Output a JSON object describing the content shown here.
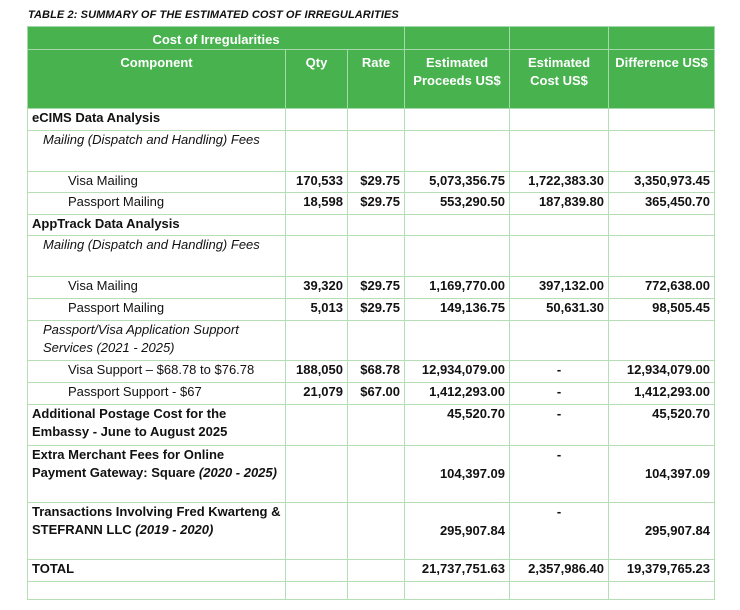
{
  "caption": "TABLE 2: SUMMARY OF THE ESTIMATED COST OF IRREGULARITIES",
  "header": {
    "group": "Cost of Irregularities",
    "component": "Component",
    "qty": "Qty",
    "rate": "Rate",
    "proceeds": "Estimated Proceeds US$",
    "cost": "Estimated Cost US$",
    "difference": "Difference US$"
  },
  "sections": {
    "ecims": "eCIMS Data Analysis",
    "ecims_mailing": "Mailing (Dispatch and Handling) Fees",
    "apptrack": "AppTrack Data Analysis",
    "apptrack_mailing": "Mailing (Dispatch and Handling) Fees",
    "support": "Passport/Visa Application Support Services (2021 - 2025)"
  },
  "rows": {
    "ecims_visa": {
      "label": "Visa Mailing",
      "qty": "170,533",
      "rate": "$29.75",
      "proceeds": "5,073,356.75",
      "cost": "1,722,383.30",
      "diff": "3,350,973.45"
    },
    "ecims_passport": {
      "label": "Passport Mailing",
      "qty": "18,598",
      "rate": "$29.75",
      "proceeds": "553,290.50",
      "cost": "187,839.80",
      "diff": "365,450.70"
    },
    "app_visa": {
      "label": "Visa Mailing",
      "qty": "39,320",
      "rate": "$29.75",
      "proceeds": "1,169,770.00",
      "cost": "397,132.00",
      "diff": "772,638.00"
    },
    "app_passport": {
      "label": "Passport Mailing",
      "qty": "5,013",
      "rate": "$29.75",
      "proceeds": "149,136.75",
      "cost": "50,631.30",
      "diff": "98,505.45"
    },
    "visa_support": {
      "label": "Visa Support – $68.78 to $76.78",
      "qty": "188,050",
      "rate": "$68.78",
      "proceeds": "12,934,079.00",
      "cost": "-",
      "diff": "12,934,079.00"
    },
    "passport_support": {
      "label": "Passport Support - $67",
      "qty": "21,079",
      "rate": "$67.00",
      "proceeds": "1,412,293.00",
      "cost": "-",
      "diff": "1,412,293.00"
    },
    "postage": {
      "label": "Additional Postage Cost for the Embassy - June to August 2025",
      "proceeds": "45,520.70",
      "cost": "-",
      "diff": "45,520.70"
    },
    "merchant": {
      "label": "Extra Merchant Fees for Online Payment Gateway: Square",
      "label_ital": "(2020 - 2025)",
      "proceeds": "104,397.09",
      "cost": "-",
      "diff": "104,397.09"
    },
    "fred": {
      "label": "Transactions Involving Fred Kwarteng & STEFRANN LLC",
      "label_ital": "(2019 - 2020)",
      "proceeds": "295,907.84",
      "cost": "-",
      "diff": "295,907.84"
    },
    "total": {
      "label": "TOTAL",
      "proceeds": "21,737,751.63",
      "cost": "2,357,986.40",
      "diff": "19,379,765.23"
    }
  },
  "colors": {
    "header_bg": "#48b24f",
    "border": "#b5deb5"
  }
}
